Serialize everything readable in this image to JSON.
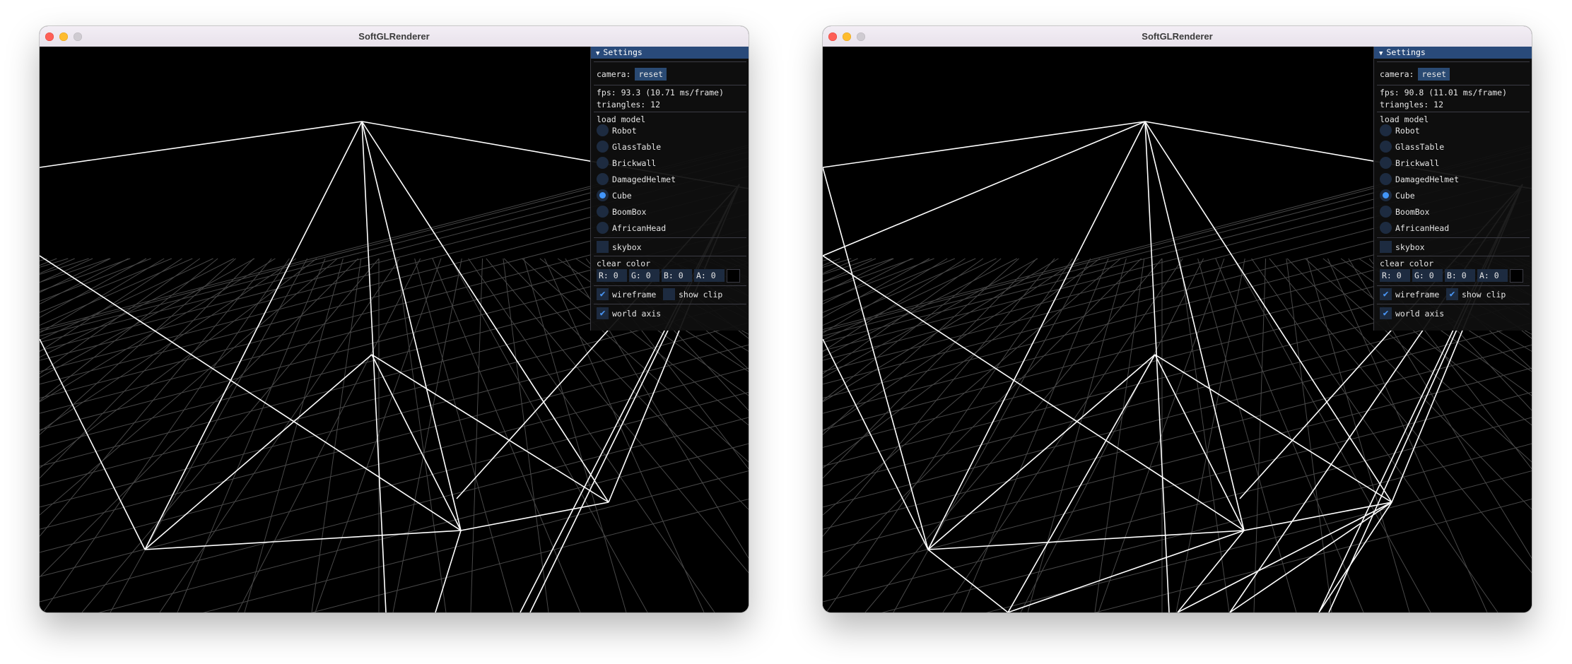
{
  "windows": [
    {
      "title": "SoftGLRenderer",
      "settings": {
        "header": "Settings",
        "camera_label": "camera:",
        "reset_label": "reset",
        "fps_text": "fps: 93.3 (10.71 ms/frame)",
        "triangles_text": "triangles: 12",
        "load_model_label": "load model",
        "models": [
          "Robot",
          "GlassTable",
          "Brickwall",
          "DamagedHelmet",
          "Cube",
          "BoomBox",
          "AfricanHead"
        ],
        "selected_model": "Cube",
        "skybox_label": "skybox",
        "skybox_checked": false,
        "clear_color_label": "clear color",
        "color_fields": [
          "R:  0",
          "G:  0",
          "B:  0",
          "A:  0"
        ],
        "wireframe_label": "wireframe",
        "wireframe_checked": true,
        "show_clip_label": "show clip",
        "show_clip_checked": false,
        "world_axis_label": "world axis",
        "world_axis_checked": true
      }
    },
    {
      "title": "SoftGLRenderer",
      "settings": {
        "header": "Settings",
        "camera_label": "camera:",
        "reset_label": "reset",
        "fps_text": "fps: 90.8 (11.01 ms/frame)",
        "triangles_text": "triangles: 12",
        "load_model_label": "load model",
        "models": [
          "Robot",
          "GlassTable",
          "Brickwall",
          "DamagedHelmet",
          "Cube",
          "BoomBox",
          "AfricanHead"
        ],
        "selected_model": "Cube",
        "skybox_label": "skybox",
        "skybox_checked": false,
        "clear_color_label": "clear color",
        "color_fields": [
          "R:  0",
          "G:  0",
          "B:  0",
          "A:  0"
        ],
        "wireframe_label": "wireframe",
        "wireframe_checked": true,
        "show_clip_label": "show clip",
        "show_clip_checked": true,
        "world_axis_label": "world axis",
        "world_axis_checked": true
      }
    }
  ],
  "colors": {
    "panel_header": "#294a7a",
    "checkmark": "#4a96f5",
    "radio_selected": "#4296fa",
    "wire": "#ffffff",
    "grid": "#5a5a5a"
  }
}
